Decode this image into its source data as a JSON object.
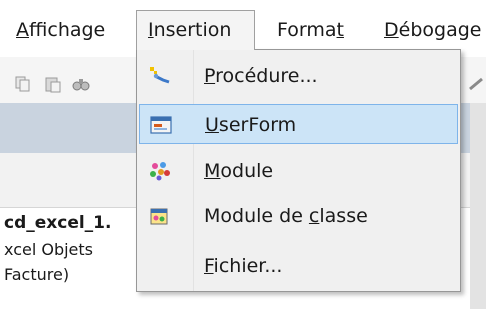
{
  "menubar": {
    "items": [
      {
        "label": "Affichage",
        "mnemonic_index": 0
      },
      {
        "label": "Insertion",
        "mnemonic_index": 0
      },
      {
        "label": "Format",
        "mnemonic_index": 5
      },
      {
        "label": "Débogage",
        "mnemonic_index": 0
      }
    ]
  },
  "menubar_display": {
    "affichage_mn": "A",
    "affichage_rest": "ffichage",
    "insertion_mn": "I",
    "insertion_rest": "nsertion",
    "format_pre": "Forma",
    "format_mn": "t",
    "debogage_mn": "D",
    "debogage_rest": "ébogage"
  },
  "dropdown": {
    "items": [
      {
        "id": "procedure",
        "label": "Procédure...",
        "icon": "procedure-icon",
        "highlighted": false
      },
      {
        "id": "userform",
        "label": "UserForm",
        "icon": "userform-icon",
        "highlighted": true
      },
      {
        "id": "module",
        "label": "Module",
        "icon": "module-icon",
        "highlighted": false
      },
      {
        "id": "class-module",
        "label": "Module de classe",
        "icon": "class-module-icon",
        "highlighted": false
      },
      {
        "id": "file",
        "label": "Fichier...",
        "icon": "",
        "highlighted": false
      }
    ],
    "display": {
      "procedure_mn": "P",
      "procedure_rest": "rocédure...",
      "userform_mn": "U",
      "userform_rest": "serForm",
      "module_mn": "M",
      "module_rest": "odule",
      "class_pre": "Module de ",
      "class_mn": "c",
      "class_rest": "lasse",
      "file_mn": "F",
      "file_rest": "ichier..."
    }
  },
  "project_tree": {
    "line1": "cd_excel_1.",
    "line2": "xcel Objets",
    "line3": "Facture)"
  },
  "colors": {
    "highlight_bg": "#cce4f7",
    "highlight_border": "#7eb4ea",
    "panel_header": "#c9d3df"
  }
}
